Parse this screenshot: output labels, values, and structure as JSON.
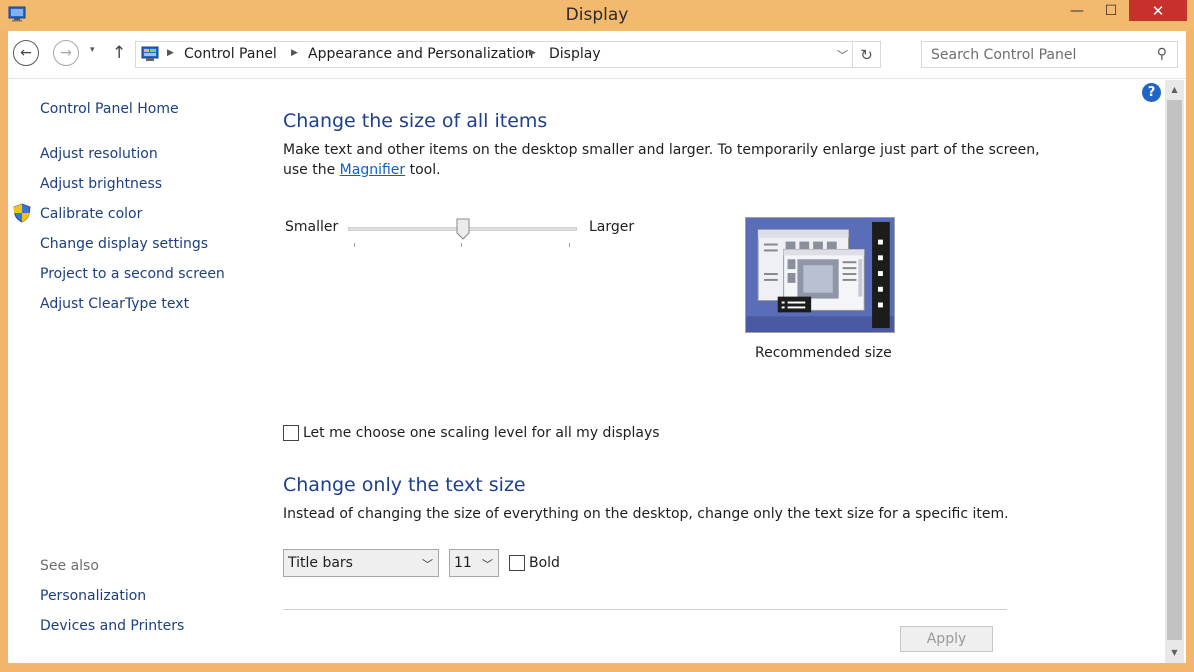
{
  "window": {
    "title": "Display",
    "minimize_glyph": "—",
    "maximize_glyph": "☐",
    "close_glyph": "✕",
    "accent": "#f3b96e",
    "close_color": "#c7312b"
  },
  "navigation": {
    "back_glyph": "←",
    "forward_glyph": "→",
    "recent_glyph": "▾",
    "up_glyph": "↑",
    "breadcrumbs": [
      "Control Panel",
      "Appearance and Personalization",
      "Display"
    ],
    "separator_glyph": "▶",
    "dropdown_glyph": "﹀",
    "refresh_glyph": "↻",
    "search_placeholder": "Search Control Panel",
    "search_glyph": "⚲"
  },
  "help": {
    "glyph": "?"
  },
  "sidebar": {
    "home": "Control Panel Home",
    "items": [
      "Adjust resolution",
      "Adjust brightness",
      "Calibrate color",
      "Change display settings",
      "Project to a second screen",
      "Adjust ClearType text"
    ],
    "see_also": "See also",
    "see_also_items": [
      "Personalization",
      "Devices and Printers"
    ]
  },
  "main": {
    "section1_title": "Change the size of all items",
    "section1_desc_line1": "Make text and other items on the desktop smaller and larger. To temporarily enlarge just part of the screen,",
    "section1_desc_use": "use the ",
    "section1_desc_link": "Magnifier",
    "section1_desc_end": " tool.",
    "slider_min_label": "Smaller",
    "slider_max_label": "Larger",
    "slider_value_fraction": 0.5,
    "preview_caption": "Recommended size",
    "scaling_checkbox_label": "Let me choose one scaling level for all my displays",
    "scaling_checkbox_checked": false,
    "section2_title": "Change only the text size",
    "section2_desc": "Instead of changing the size of everything on the desktop, change only the text size for a specific item.",
    "item_select_value": "Title bars",
    "size_select_value": "11",
    "select_chevron": "﹀",
    "bold_label": "Bold",
    "bold_checked": false,
    "apply_label": "Apply"
  },
  "scrollbar": {
    "up_glyph": "▲",
    "down_glyph": "▼"
  }
}
